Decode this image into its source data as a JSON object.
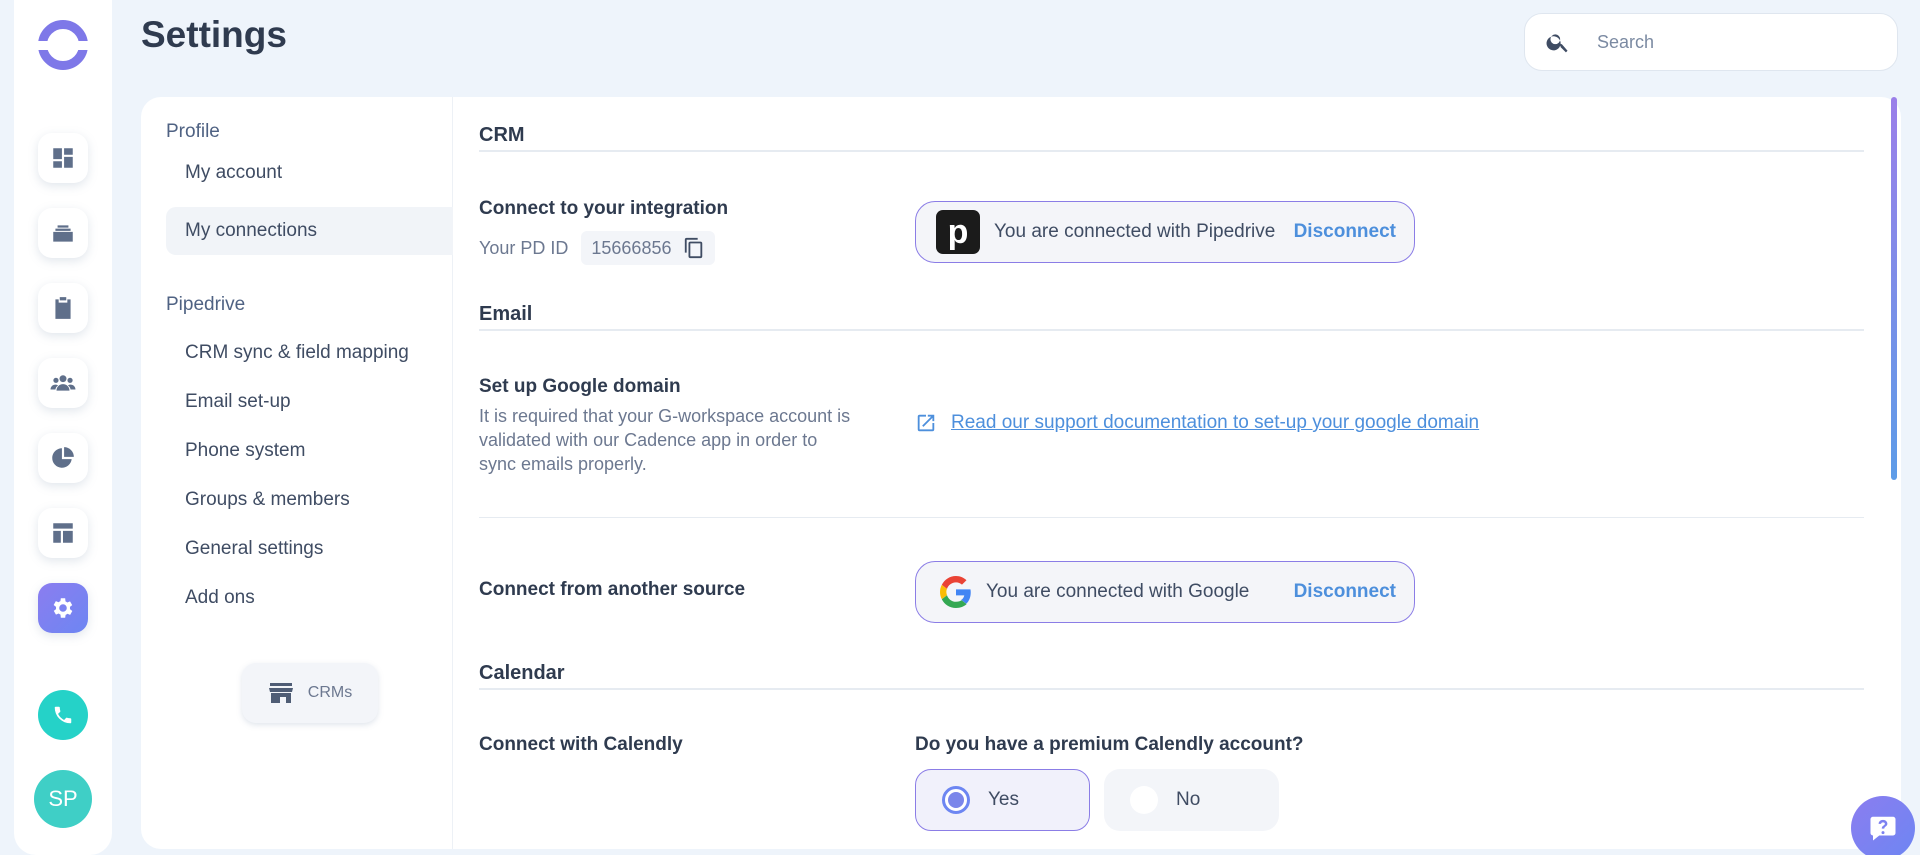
{
  "header": {
    "title": "Settings",
    "search_placeholder": "Search"
  },
  "rail": {
    "items": [
      {
        "icon": "dashboard-icon"
      },
      {
        "icon": "inbox-stack-icon"
      },
      {
        "icon": "clipboard-icon"
      },
      {
        "icon": "people-icon"
      },
      {
        "icon": "pie-chart-icon"
      },
      {
        "icon": "template-icon"
      },
      {
        "icon": "gear-icon",
        "active": true
      }
    ],
    "phone_icon": "phone-icon",
    "avatar_initials": "SP"
  },
  "subnav": {
    "profile_heading": "Profile",
    "profile_items": [
      "My account",
      "My connections"
    ],
    "pipedrive_heading": "Pipedrive",
    "pipedrive_items": [
      "CRM sync & field mapping",
      "Email set-up",
      "Phone system",
      "Groups & members",
      "General settings",
      "Add ons"
    ],
    "crm_button": "CRMs",
    "active_item": "My connections"
  },
  "crm": {
    "heading": "CRM",
    "connect_label": "Connect to your integration",
    "pd_id_label": "Your PD ID",
    "pd_id_value": "15666856",
    "status_text": "You are connected with Pipedrive",
    "disconnect_label": "Disconnect",
    "logo_letter": "p"
  },
  "email": {
    "heading": "Email",
    "google_domain_label": "Set up Google domain",
    "google_domain_desc": "It is required that your G-workspace account is validated with our Cadence app in order to sync emails properly.",
    "doc_link": "Read our support documentation to set-up your google domain",
    "another_source_label": "Connect from another source",
    "status_text": "You are connected with Google",
    "disconnect_label": "Disconnect"
  },
  "calendar": {
    "heading": "Calendar",
    "calendly_label": "Connect with Calendly",
    "question": "Do you have a premium Calendly account?",
    "options": [
      "Yes",
      "No"
    ],
    "selected": "Yes"
  },
  "colors": {
    "accent": "#7e78e8",
    "link": "#4d8fdc",
    "teal": "#25d2c8"
  }
}
